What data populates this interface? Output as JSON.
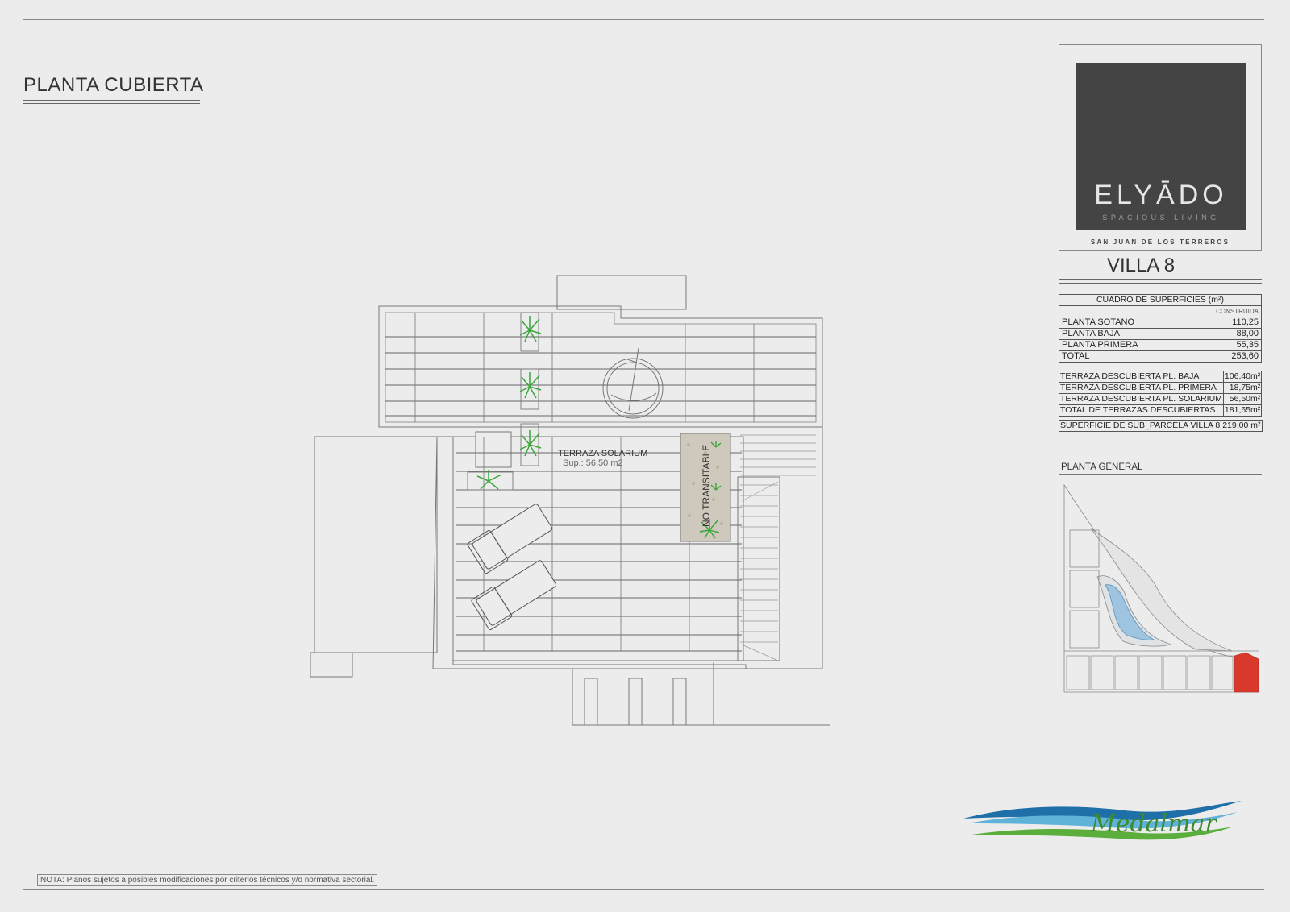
{
  "sheet_title": "PLANTA CUBIERTA",
  "brand": {
    "name": "ELYĀDO",
    "tagline": "SPACIOUS LIVING",
    "location": "SAN JUAN DE LOS TERREROS"
  },
  "villa_label": "VILLA 8",
  "surfaces": {
    "heading": "CUADRO DE SUPERFICIES (m²)",
    "column": "CONSTRUIDA",
    "rows": [
      {
        "label": "PLANTA SOTANO",
        "value": "110,25"
      },
      {
        "label": "PLANTA BAJA",
        "value": "88,00"
      },
      {
        "label": "PLANTA PRIMERA",
        "value": "55,35"
      },
      {
        "label": "TOTAL",
        "value": "253,60"
      }
    ]
  },
  "terraces": [
    {
      "label": "TERRAZA DESCUBIERTA PL. BAJA",
      "value": "106,40m²"
    },
    {
      "label": "TERRAZA DESCUBIERTA PL. PRIMERA",
      "value": "18,75m²"
    },
    {
      "label": "TERRAZA DESCUBIERTA PL. SOLARIUM",
      "value": "56,50m²"
    },
    {
      "label": "TOTAL DE TERRAZAS DESCUBIERTAS",
      "value": "181,65m²"
    }
  ],
  "parcel": {
    "label": "SUPERFICIE DE SUB_PARCELA VILLA 8",
    "value": "219,00 m²"
  },
  "general_plan_label": "PLANTA GENERAL",
  "plan": {
    "terrace_name": "TERRAZA SOLARIUM",
    "terrace_area": "Sup.: 56,50 m2",
    "non_walkable": "NO TRANSITABLE"
  },
  "developer": "Medalmar",
  "note": "NOTA: Planos sujetos a posibles modificaciones por criterios técnicos y/o normativa sectorial.",
  "colors": {
    "background": "#ececec",
    "logo_box": "#444444",
    "plot_highlight": "#d9392b",
    "plant_green": "#3aa63a",
    "wave_blue": "#1f6fa8",
    "wave_green": "#5cae3c"
  }
}
